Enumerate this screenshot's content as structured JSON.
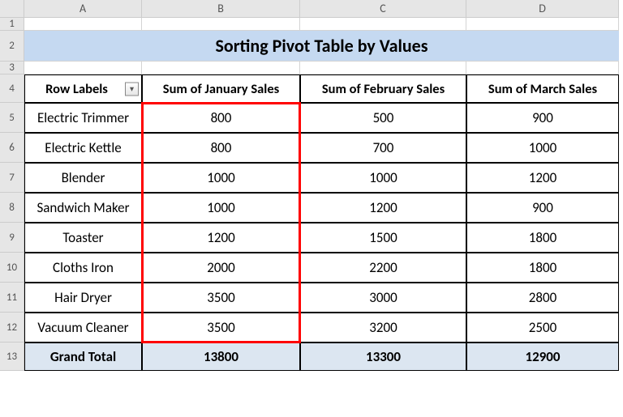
{
  "columns": [
    "A",
    "B",
    "C",
    "D"
  ],
  "row_numbers": [
    "1",
    "2",
    "3",
    "4",
    "5",
    "6",
    "7",
    "8",
    "9",
    "10",
    "11",
    "12",
    "13"
  ],
  "title": "Sorting Pivot Table by Values",
  "headers": {
    "row_labels": "Row Labels",
    "jan": "Sum of January Sales",
    "feb": "Sum of February Sales",
    "mar": "Sum of March Sales"
  },
  "rows": [
    {
      "label": "Electric Trimmer",
      "jan": "800",
      "feb": "500",
      "mar": "900"
    },
    {
      "label": "Electric Kettle",
      "jan": "800",
      "feb": "700",
      "mar": "1000"
    },
    {
      "label": "Blender",
      "jan": "1000",
      "feb": "1000",
      "mar": "1200"
    },
    {
      "label": "Sandwich Maker",
      "jan": "1000",
      "feb": "1200",
      "mar": "900"
    },
    {
      "label": "Toaster",
      "jan": "1200",
      "feb": "1500",
      "mar": "1800"
    },
    {
      "label": "Cloths Iron",
      "jan": "2000",
      "feb": "2200",
      "mar": "1800"
    },
    {
      "label": "Hair Dryer",
      "jan": "3500",
      "feb": "3000",
      "mar": "2800"
    },
    {
      "label": "Vacuum Cleaner",
      "jan": "3500",
      "feb": "3200",
      "mar": "2500"
    }
  ],
  "grand_total": {
    "label": "Grand Total",
    "jan": "13800",
    "feb": "13300",
    "mar": "12900"
  },
  "chart_data": {
    "type": "table",
    "title": "Sorting Pivot Table by Values",
    "columns": [
      "Row Labels",
      "Sum of January Sales",
      "Sum of February Sales",
      "Sum of March Sales"
    ],
    "rows": [
      [
        "Electric Trimmer",
        800,
        500,
        900
      ],
      [
        "Electric Kettle",
        800,
        700,
        1000
      ],
      [
        "Blender",
        1000,
        1000,
        1200
      ],
      [
        "Sandwich Maker",
        1000,
        1200,
        900
      ],
      [
        "Toaster",
        1200,
        1500,
        1800
      ],
      [
        "Cloths Iron",
        2000,
        2200,
        1800
      ],
      [
        "Hair Dryer",
        3500,
        3000,
        2800
      ],
      [
        "Vacuum Cleaner",
        3500,
        3200,
        2500
      ],
      [
        "Grand Total",
        13800,
        13300,
        12900
      ]
    ],
    "highlight": "Sum of January Sales column (rows 5–12) outlined in red"
  }
}
